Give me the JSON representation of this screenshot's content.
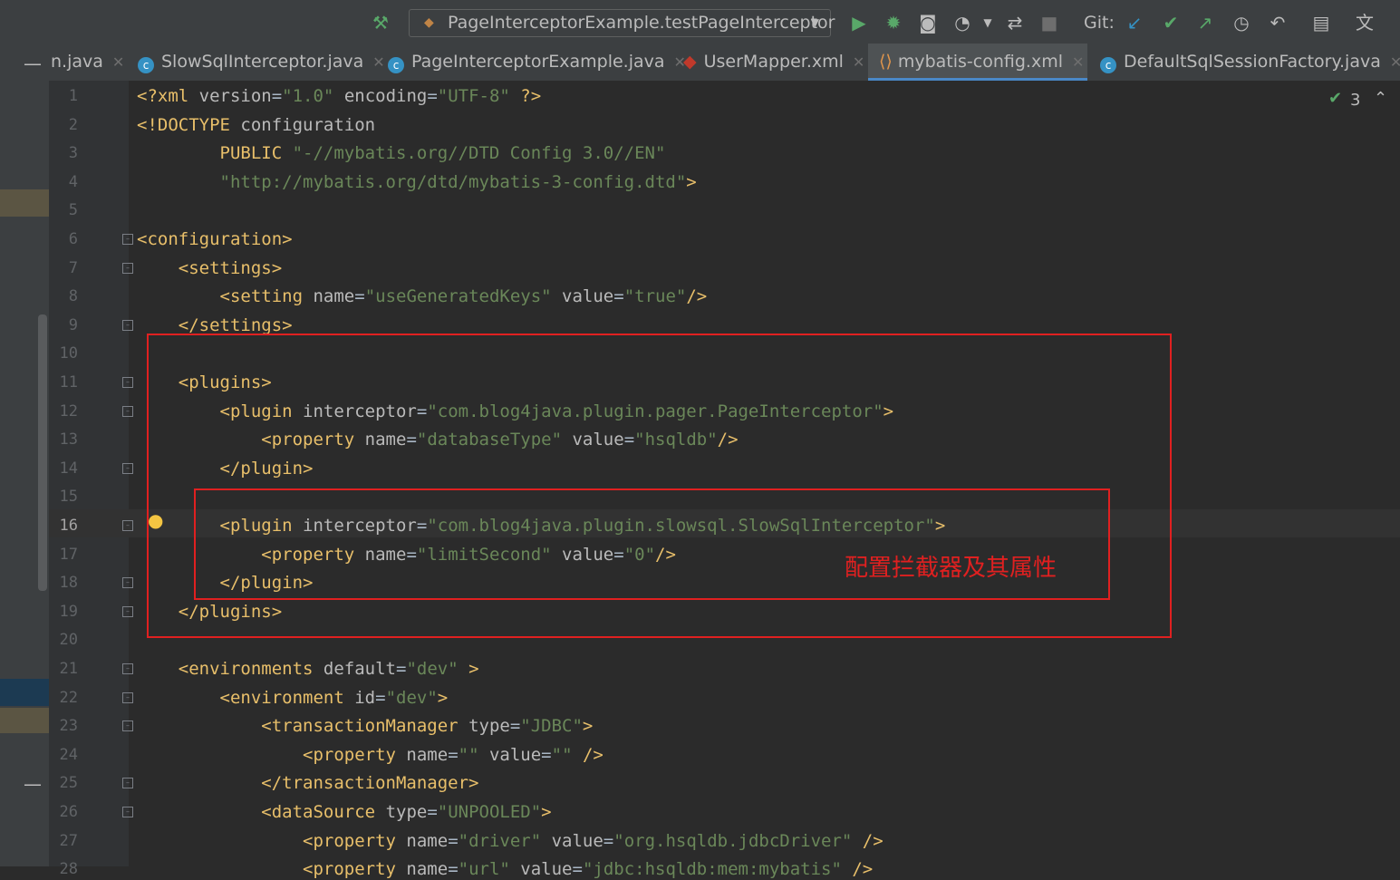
{
  "toolbar": {
    "run_config": "PageInterceptorExample.testPageInterceptor",
    "git_label": "Git:"
  },
  "tabs": [
    {
      "label": "n.java",
      "icon": "java-icon"
    },
    {
      "label": "SlowSqlInterceptor.java",
      "icon": "class-icon"
    },
    {
      "label": "PageInterceptorExample.java",
      "icon": "class-icon"
    },
    {
      "label": "UserMapper.xml",
      "icon": "mybatis-icon"
    },
    {
      "label": "mybatis-config.xml",
      "icon": "xml-icon",
      "active": true
    },
    {
      "label": "DefaultSqlSessionFactory.java",
      "icon": "class-icon"
    }
  ],
  "inspection": {
    "count": "3"
  },
  "lines": [
    [
      [
        "tg",
        "<?xml "
      ],
      [
        "at",
        "version"
      ],
      [
        "pl",
        "="
      ],
      [
        "vl",
        "\"1.0\""
      ],
      [
        "at",
        " encoding"
      ],
      [
        "pl",
        "="
      ],
      [
        "vl",
        "\"UTF-8\""
      ],
      [
        "tg",
        " ?>"
      ]
    ],
    [
      [
        "tg",
        "<!DOCTYPE "
      ],
      [
        "at",
        "configuration"
      ]
    ],
    [
      [
        "pl",
        "        "
      ],
      [
        "tg",
        "PUBLIC "
      ],
      [
        "vl",
        "\"-//mybatis.org//DTD Config 3.0//EN\""
      ]
    ],
    [
      [
        "pl",
        "        "
      ],
      [
        "vl",
        "\"http://mybatis.org/dtd/mybatis-3-config.dtd\""
      ],
      [
        "tg",
        ">"
      ]
    ],
    [],
    [
      [
        "tg",
        "<configuration>"
      ]
    ],
    [
      [
        "pl",
        "    "
      ],
      [
        "tg",
        "<settings>"
      ]
    ],
    [
      [
        "pl",
        "        "
      ],
      [
        "tg",
        "<setting "
      ],
      [
        "at",
        "name"
      ],
      [
        "pl",
        "="
      ],
      [
        "vl",
        "\"useGeneratedKeys\""
      ],
      [
        "at",
        " value"
      ],
      [
        "pl",
        "="
      ],
      [
        "vl",
        "\"true\""
      ],
      [
        "tg",
        "/>"
      ]
    ],
    [
      [
        "pl",
        "    "
      ],
      [
        "tg",
        "</settings>"
      ]
    ],
    [],
    [
      [
        "pl",
        "    "
      ],
      [
        "tg",
        "<plugins>"
      ]
    ],
    [
      [
        "pl",
        "        "
      ],
      [
        "tg",
        "<plugin "
      ],
      [
        "at",
        "interceptor"
      ],
      [
        "pl",
        "="
      ],
      [
        "vl",
        "\"com.blog4java.plugin.pager.PageInterceptor\""
      ],
      [
        "tg",
        ">"
      ]
    ],
    [
      [
        "pl",
        "            "
      ],
      [
        "tg",
        "<property "
      ],
      [
        "at",
        "name"
      ],
      [
        "pl",
        "="
      ],
      [
        "vl",
        "\"databaseType\""
      ],
      [
        "at",
        " value"
      ],
      [
        "pl",
        "="
      ],
      [
        "vl",
        "\"hsqldb\""
      ],
      [
        "tg",
        "/>"
      ]
    ],
    [
      [
        "pl",
        "        "
      ],
      [
        "tg",
        "</plugin>"
      ]
    ],
    [],
    [
      [
        "pl",
        "        "
      ],
      [
        "tg",
        "<plugin "
      ],
      [
        "at",
        "interceptor"
      ],
      [
        "pl",
        "="
      ],
      [
        "vl",
        "\"com.blog4java.plugin.slowsql.SlowSqlInterceptor\""
      ],
      [
        "tg",
        ">"
      ]
    ],
    [
      [
        "pl",
        "            "
      ],
      [
        "tg",
        "<property "
      ],
      [
        "at",
        "name"
      ],
      [
        "pl",
        "="
      ],
      [
        "vl",
        "\"limitSecond\""
      ],
      [
        "at",
        " value"
      ],
      [
        "pl",
        "="
      ],
      [
        "vl",
        "\"0\""
      ],
      [
        "tg",
        "/>"
      ]
    ],
    [
      [
        "pl",
        "        "
      ],
      [
        "tg",
        "</plugin>"
      ]
    ],
    [
      [
        "pl",
        "    "
      ],
      [
        "tg",
        "</plugins>"
      ]
    ],
    [],
    [
      [
        "pl",
        "    "
      ],
      [
        "tg",
        "<environments "
      ],
      [
        "at",
        "default"
      ],
      [
        "pl",
        "="
      ],
      [
        "vl",
        "\"dev\""
      ],
      [
        "tg",
        " >"
      ]
    ],
    [
      [
        "pl",
        "        "
      ],
      [
        "tg",
        "<environment "
      ],
      [
        "at",
        "id"
      ],
      [
        "pl",
        "="
      ],
      [
        "vl",
        "\"dev\""
      ],
      [
        "tg",
        ">"
      ]
    ],
    [
      [
        "pl",
        "            "
      ],
      [
        "tg",
        "<transactionManager "
      ],
      [
        "at",
        "type"
      ],
      [
        "pl",
        "="
      ],
      [
        "vl",
        "\"JDBC\""
      ],
      [
        "tg",
        ">"
      ]
    ],
    [
      [
        "pl",
        "                "
      ],
      [
        "tg",
        "<property "
      ],
      [
        "at",
        "name"
      ],
      [
        "pl",
        "="
      ],
      [
        "vl",
        "\"\""
      ],
      [
        "at",
        " value"
      ],
      [
        "pl",
        "="
      ],
      [
        "vl",
        "\"\""
      ],
      [
        "tg",
        " />"
      ]
    ],
    [
      [
        "pl",
        "            "
      ],
      [
        "tg",
        "</transactionManager>"
      ]
    ],
    [
      [
        "pl",
        "            "
      ],
      [
        "tg",
        "<dataSource "
      ],
      [
        "at",
        "type"
      ],
      [
        "pl",
        "="
      ],
      [
        "vl",
        "\"UNPOOLED\""
      ],
      [
        "tg",
        ">"
      ]
    ],
    [
      [
        "pl",
        "                "
      ],
      [
        "tg",
        "<property "
      ],
      [
        "at",
        "name"
      ],
      [
        "pl",
        "="
      ],
      [
        "vl",
        "\"driver\""
      ],
      [
        "at",
        " value"
      ],
      [
        "pl",
        "="
      ],
      [
        "vl",
        "\"org.hsqldb.jdbcDriver\""
      ],
      [
        "tg",
        " />"
      ]
    ],
    [
      [
        "pl",
        "                "
      ],
      [
        "tg",
        "<property "
      ],
      [
        "at",
        "name"
      ],
      [
        "pl",
        "="
      ],
      [
        "vl",
        "\"url\""
      ],
      [
        "at",
        " value"
      ],
      [
        "pl",
        "="
      ],
      [
        "vl",
        "\"jdbc:hsqldb:mem:mybatis\""
      ],
      [
        "tg",
        " />"
      ]
    ]
  ],
  "annotation": "配置拦截器及其属性",
  "colors": {
    "accent_box": "#e02020",
    "tag": "#e8bf6a",
    "value": "#6a8759"
  }
}
